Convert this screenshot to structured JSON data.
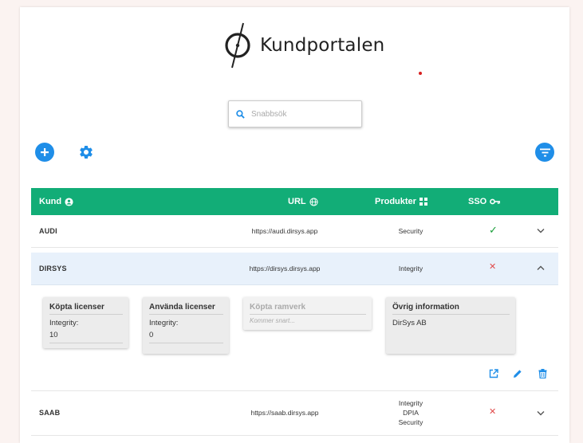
{
  "app": {
    "title": "Kundportalen"
  },
  "search": {
    "placeholder": "Snabbsök",
    "value": ""
  },
  "toolbar": {
    "add_icon": "plus-icon",
    "settings_icon": "gear-icon",
    "filter_icon": "filter-icon"
  },
  "colors": {
    "primary": "#1f8ee8",
    "header": "#12ad77",
    "check": "#1a9e3a",
    "cross": "#e04b4b",
    "active_row": "#e8f1fb"
  },
  "table": {
    "headers": {
      "customer": "Kund",
      "url": "URL",
      "products": "Produkter",
      "sso": "SSO"
    },
    "rows": [
      {
        "name": "AUDI",
        "url": "https://audi.dirsys.app",
        "products": [
          "Security"
        ],
        "sso": "✓",
        "sso_enabled": true,
        "expanded": false
      },
      {
        "name": "DIRSYS",
        "url": "https://dirsys.dirsys.app",
        "products": [
          "Integrity"
        ],
        "sso": "✕",
        "sso_enabled": false,
        "expanded": true
      },
      {
        "name": "SAAB",
        "url": "https://saab.dirsys.app",
        "products": [
          "Integrity",
          "DPIA",
          "Security"
        ],
        "sso": "✕",
        "sso_enabled": false,
        "expanded": false
      }
    ]
  },
  "details": {
    "purchased": {
      "title": "Köpta licenser",
      "label": "Integrity:",
      "value": "10"
    },
    "used": {
      "title": "Använda licenser",
      "label": "Integrity:",
      "value": "0"
    },
    "frameworks": {
      "title": "Köpta ramverk",
      "note": "Kommer snart..."
    },
    "other": {
      "title": "Övrig information",
      "text": "DirSys AB"
    }
  }
}
